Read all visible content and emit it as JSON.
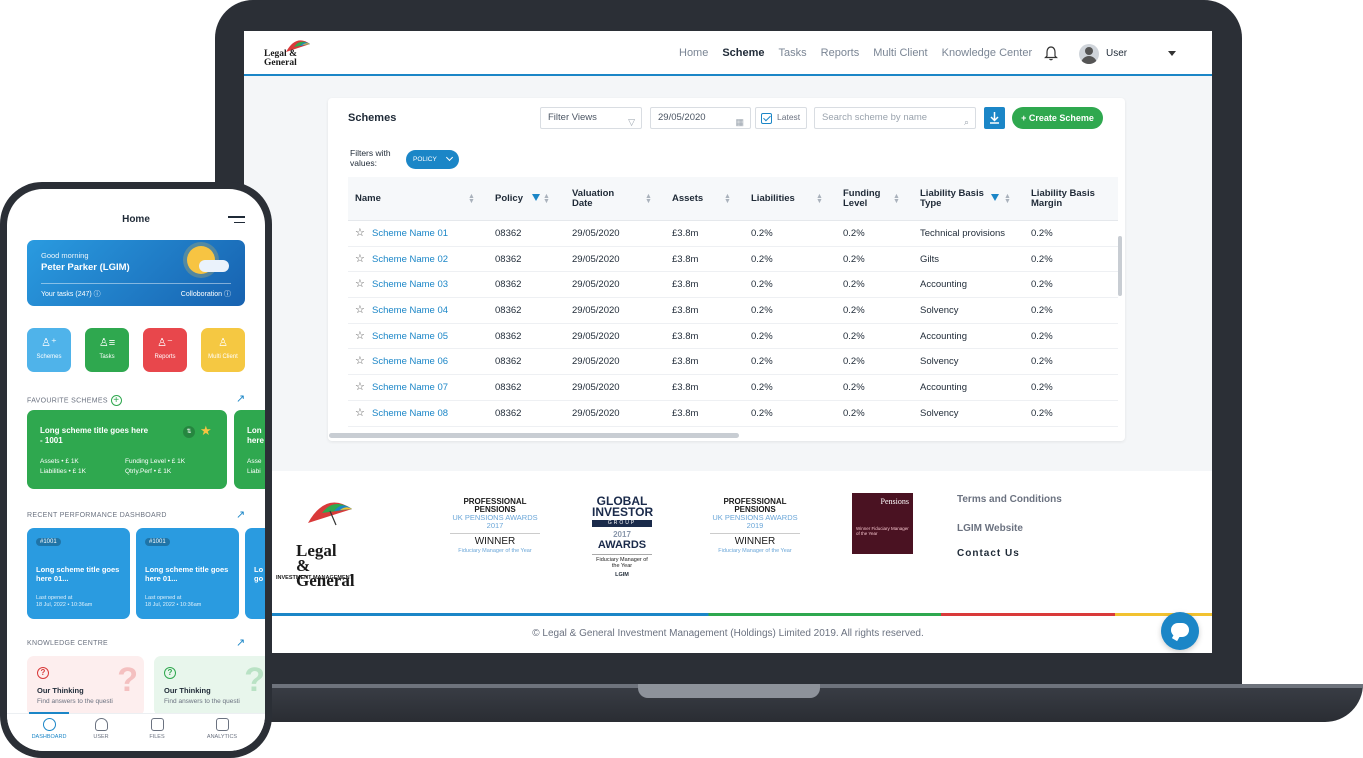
{
  "colors": {
    "brand_blue": "#1b86c7",
    "brand_green": "#2fa84f",
    "brand_red": "#d93a3a",
    "brand_yellow": "#f2c230"
  },
  "nav": {
    "logo_text_1": "Legal &",
    "logo_text_2": "General",
    "links": [
      "Home",
      "Scheme",
      "Tasks",
      "Reports",
      "Multi Client",
      "Knowledge Center"
    ],
    "active": "Scheme",
    "user": "User"
  },
  "panel": {
    "title": "Schemes",
    "filter_views": "Filter Views",
    "date": "29/05/2020",
    "latest": "Latest",
    "search_placeholder": "Search scheme by name",
    "create_label": "+ Create Scheme",
    "filters_label": "Filters with values:",
    "policy_chip": "POLICY"
  },
  "table": {
    "columns": [
      "Name",
      "Policy",
      "Valuation Date",
      "Assets",
      "Liabilities",
      "Funding Level",
      "Liability Basis Type",
      "Liability Basis Margin"
    ],
    "rows": [
      [
        "Scheme Name 01",
        "08362",
        "29/05/2020",
        "£3.8m",
        "0.2%",
        "0.2%",
        "Technical provisions",
        "0.2%"
      ],
      [
        "Scheme Name 02",
        "08362",
        "29/05/2020",
        "£3.8m",
        "0.2%",
        "0.2%",
        "Gilts",
        "0.2%"
      ],
      [
        "Scheme Name 03",
        "08362",
        "29/05/2020",
        "£3.8m",
        "0.2%",
        "0.2%",
        "Accounting",
        "0.2%"
      ],
      [
        "Scheme Name 04",
        "08362",
        "29/05/2020",
        "£3.8m",
        "0.2%",
        "0.2%",
        "Solvency",
        "0.2%"
      ],
      [
        "Scheme Name 05",
        "08362",
        "29/05/2020",
        "£3.8m",
        "0.2%",
        "0.2%",
        "Accounting",
        "0.2%"
      ],
      [
        "Scheme Name 06",
        "08362",
        "29/05/2020",
        "£3.8m",
        "0.2%",
        "0.2%",
        "Solvency",
        "0.2%"
      ],
      [
        "Scheme Name 07",
        "08362",
        "29/05/2020",
        "£3.8m",
        "0.2%",
        "0.2%",
        "Accounting",
        "0.2%"
      ],
      [
        "Scheme Name 08",
        "08362",
        "29/05/2020",
        "£3.8m",
        "0.2%",
        "0.2%",
        "Solvency",
        "0.2%"
      ]
    ]
  },
  "footer": {
    "logo_1": "Legal &",
    "logo_2": "General",
    "logo_sub": "INVESTMENT MANAGEMENT",
    "award_2017": {
      "title": "PROFESSIONAL PENSIONS",
      "sub": "UK PENSIONS AWARDS 2017",
      "result": "WINNER",
      "category": "Fiduciary Manager of the Year"
    },
    "global": {
      "l1": "GLOBAL",
      "l2": "INVESTOR",
      "group": "GROUP",
      "l3": "2017",
      "l4": "AWARDS",
      "cat": "Fiduciary Manager of the Year",
      "org": "LGIM"
    },
    "award_2019": {
      "title": "PROFESSIONAL PENSIONS",
      "sub": "UK PENSIONS AWARDS 2019",
      "result": "WINNER",
      "category": "Fiduciary Manager of the Year"
    },
    "pe": {
      "brand": "Pensions",
      "text": "Winner Fiduciary Manager of the Year"
    },
    "links": [
      "Terms and Conditions",
      "LGIM Website",
      "Contact Us"
    ],
    "copyright": "© Legal & General Investment Management (Holdings) Limited 2019. All rights reserved."
  },
  "phone": {
    "title": "Home",
    "greeting": "Good morning",
    "name": "Peter Parker (LGIM)",
    "tasks": "Your tasks (247)",
    "collab": "Colloboration",
    "tiles": [
      "Schemes",
      "Tasks",
      "Reports",
      "Multi Client"
    ],
    "fav_heading": "FAVOURITE SCHEMES",
    "fav": {
      "title": "Long scheme title goes here - 1001",
      "assets": "Assets • £ 1K",
      "liabilities": "Liabilities • £ 1K",
      "funding": "Funding Level • £ 1K",
      "qtrly": "Qtrly.Perf • £ 1K"
    },
    "fav_peek": {
      "title": "Lon here",
      "assets": "Asse",
      "liab": "Liabi"
    },
    "perf_heading": "RECENT PERFORMANCE DASHBOARD",
    "perf": [
      {
        "id": "#1001",
        "title": "Long scheme title goes here 01...",
        "last": "Last opened at",
        "date": "18 Jul, 2022 • 10:36am"
      },
      {
        "id": "#1001",
        "title": "Long scheme title goes here 01...",
        "last": "Last opened at",
        "date": "18 Jul, 2022 • 10:36am"
      }
    ],
    "perf_peek": {
      "title": "Lo go"
    },
    "know_heading": "KNOWLEDGE CENTRE",
    "know": [
      {
        "title": "Our Thinking",
        "desc": "Find answers to the questi"
      },
      {
        "title": "Our Thinking",
        "desc": "Find answers to the questi"
      }
    ],
    "tabs": [
      "DASHBOARD",
      "USER",
      "FILES",
      "ANALYTICS"
    ]
  }
}
